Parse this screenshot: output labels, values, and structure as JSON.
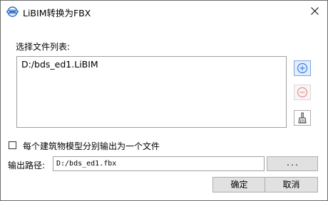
{
  "window": {
    "title": "LiBIM转换为FBX",
    "logo_icon": "libim-logo-icon",
    "close_icon": "close-icon"
  },
  "file_list": {
    "label": "选择文件列表:",
    "items": [
      "D:/bds_ed1.LiBIM"
    ]
  },
  "side_buttons": {
    "add_icon": "plus-circle-icon",
    "remove_icon": "minus-circle-icon",
    "clear_icon": "broom-icon"
  },
  "options": {
    "separate_output_label": "每个建筑物模型分别输出为一个文件",
    "separate_output_checked": false
  },
  "output": {
    "label": "输出路径:",
    "path_value": "D:/bds_ed1.fbx",
    "browse_label": "..."
  },
  "footer": {
    "ok_label": "确定",
    "cancel_label": "取消"
  },
  "colors": {
    "add_button_bg": "#e3eefb",
    "add_icon": "#3b7de0",
    "remove_icon": "#f08a8a",
    "button_bg": "#e1e1e1"
  }
}
